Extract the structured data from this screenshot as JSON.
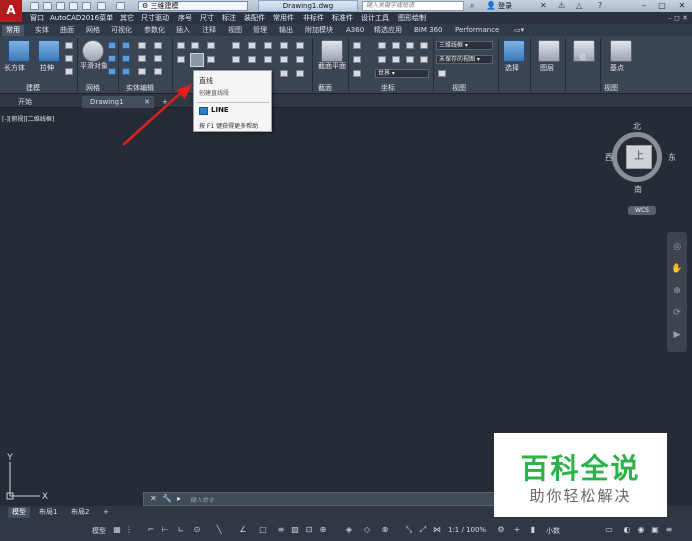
{
  "titlebar": {
    "workspace": "三维建模",
    "document_title": "Drawing1.dwg",
    "search_placeholder": "键入关键字或短语",
    "login": "登录"
  },
  "menubar": {
    "items": [
      "窗口",
      "AutoCAD2016菜单",
      "其它",
      "尺寸驱动",
      "序号",
      "尺寸",
      "标注",
      "装配件",
      "常用件",
      "非标件",
      "标准件",
      "设计工具",
      "图形绘制"
    ]
  },
  "ribbon": {
    "tabs": [
      "常用",
      "实体",
      "曲面",
      "网格",
      "可视化",
      "参数化",
      "插入",
      "注释",
      "视图",
      "管理",
      "输出",
      "附加模块",
      "A360",
      "精选应用",
      "BIM 360",
      "Performance"
    ],
    "active_tab": "常用",
    "tools": {
      "box": "长方体",
      "extrude": "拉伸",
      "smooth_object": "平滑对象",
      "section_plane": "截面平面",
      "selection": "选择",
      "layers": "图层",
      "group": "组",
      "base_point": "基点"
    },
    "dropdowns": {
      "visual_style": "三维线框",
      "view": "未保存的视图",
      "coord": "世界"
    },
    "panels": [
      "建模",
      "网格",
      "实体编辑",
      "截面",
      "坐标",
      "视图",
      "视图"
    ]
  },
  "doctabs": {
    "start": "开始",
    "drawing": "Drawing1"
  },
  "viewport": {
    "label": "[-][俯视][二维线框]",
    "viewcube": {
      "face": "上",
      "north": "北",
      "south": "南",
      "east": "东",
      "west": "西",
      "wcs": "WCS"
    }
  },
  "tooltip": {
    "title": "直线",
    "description": "创建直线段",
    "command": "LINE",
    "help": "按 F1 键获得更多帮助"
  },
  "ucs": {
    "x": "X",
    "y": "Y"
  },
  "cmdline": {
    "placeholder": "键入命令"
  },
  "layout_tabs": [
    "模型",
    "布局1",
    "布局2"
  ],
  "statusbar": {
    "model": "模型",
    "scale": "1:1 / 100%",
    "units": "小数"
  },
  "watermark": {
    "title": "百科全说",
    "subtitle": "助你轻松解决"
  },
  "colors": {
    "viewport_bg": "#252c36",
    "ribbon_bg": "#3b4452",
    "app_red": "#b11d1d",
    "watermark_green": "#2fb14a"
  }
}
